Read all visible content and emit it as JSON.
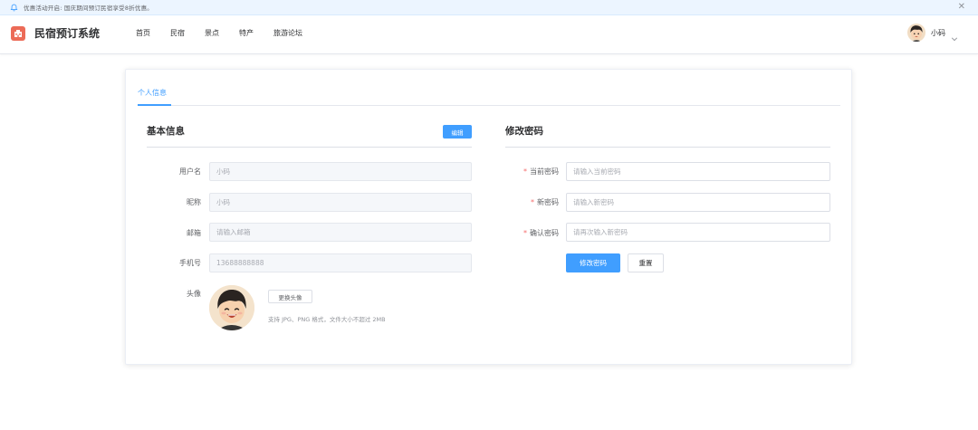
{
  "announcement": {
    "text": "优惠活动开启: 国庆期间预订民宿享受8折优惠。",
    "close_icon": "close-icon"
  },
  "header": {
    "site_title": "民宿预订系统",
    "nav": [
      "首页",
      "民宿",
      "景点",
      "特产",
      "旅游论坛"
    ],
    "user_name": "小码"
  },
  "profile": {
    "tab_label": "个人信息",
    "basic_info": {
      "title": "基本信息",
      "edit_label": "编辑",
      "username_label": "用户名",
      "username_value": "小码",
      "nickname_label": "昵称",
      "nickname_value": "小码",
      "email_label": "邮箱",
      "email_placeholder": "请输入邮箱",
      "phone_label": "手机号",
      "phone_value": "13688888888",
      "avatar_label": "头像",
      "change_avatar_label": "更换头像",
      "avatar_hint": "支持 JPG、PNG 格式，文件大小不超过 2MB"
    },
    "password": {
      "title": "修改密码",
      "required_mark": "*",
      "current_label": "当前密码",
      "current_placeholder": "请输入当前密码",
      "new_label": "新密码",
      "new_placeholder": "请输入新密码",
      "confirm_label": "确认密码",
      "confirm_placeholder": "请再次输入新密码",
      "submit_label": "修改密码",
      "reset_label": "重置"
    }
  },
  "colors": {
    "primary": "#409eff",
    "logo": "#ec6b57",
    "required": "#f56c6c",
    "announce_bg": "#ecf5ff"
  }
}
